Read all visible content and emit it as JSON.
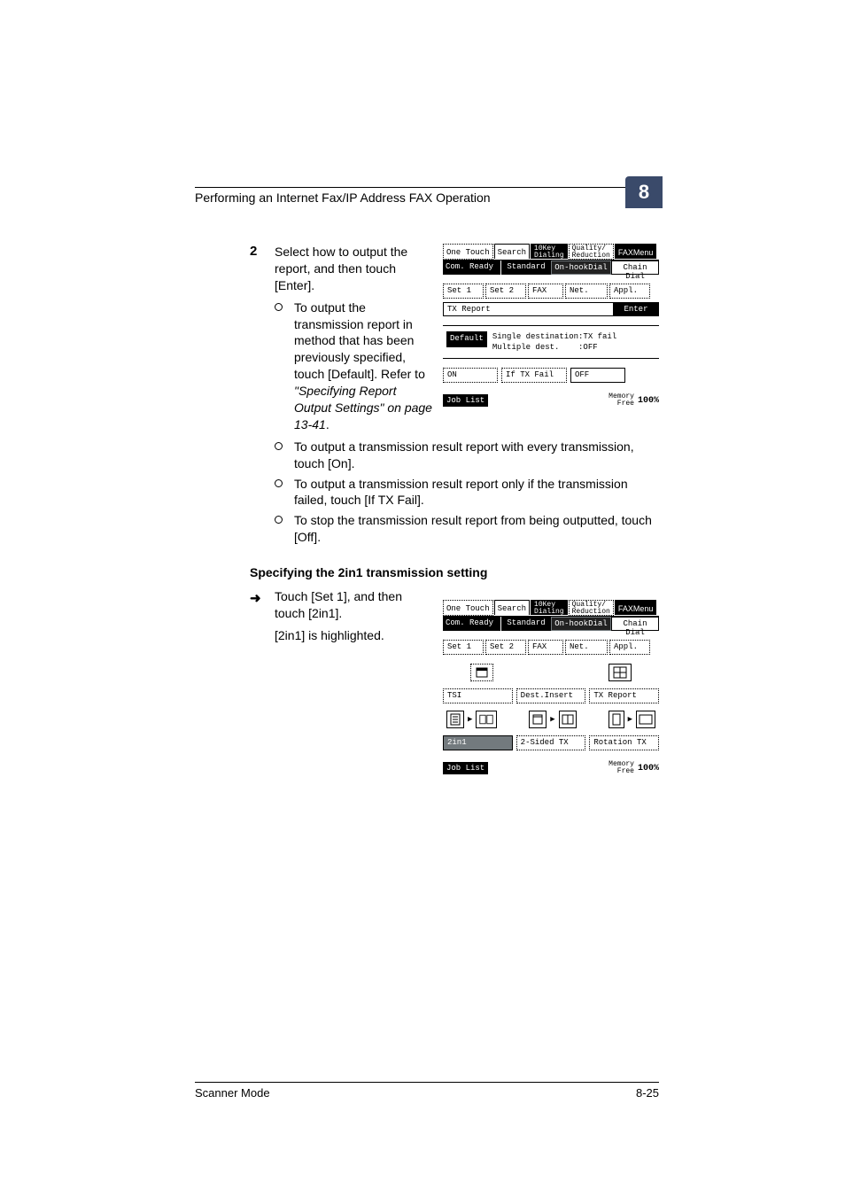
{
  "header": {
    "title": "Performing an Internet Fax/IP Address FAX Operation",
    "chapter": "8"
  },
  "step2": {
    "num": "2",
    "text": "Select how to output the report, and then touch [Enter].",
    "bullets_narrow": [
      {
        "pre": "To output the transmission report in method that has been previously specified, touch [Default]. Refer to ",
        "ref": "\"Specifying Report Output Settings\" on page 13-41",
        "post": "."
      }
    ],
    "bullets_wide": [
      "To output a transmission result report with every transmission, touch [On].",
      "To output a transmission result report only if the transmission failed, touch [If TX Fail].",
      "To stop the transmission result report from being outputted, touch [Off]."
    ]
  },
  "subheading": "Specifying the 2in1 transmission setting",
  "arrowstep": {
    "p1": "Touch [Set 1], and then touch [2in1].",
    "p2": "[2in1] is highlighted."
  },
  "lcd_common": {
    "tabs": {
      "onetouch": "One Touch",
      "search": "Search",
      "dialing_top": "10Key",
      "dialing_bot": "Dialing",
      "quality_top": "Quality/",
      "quality_bot": "Reduction",
      "faxmenu": "FAXMenu"
    },
    "status": {
      "ready": "Com. Ready",
      "standard": "Standard",
      "onhook": "On-hookDial",
      "chain": "Chain Dial"
    },
    "sets": {
      "set1": "Set 1",
      "set2": "Set 2",
      "fax": "FAX",
      "net": "Net.",
      "appl": "Appl."
    },
    "footer": {
      "joblist": "Job List",
      "memory": "Memory",
      "free": "Free",
      "pct": "100%"
    }
  },
  "lcd1": {
    "txreport": "TX Report",
    "enter": "Enter",
    "default": "Default",
    "mid_l1": "Single destination:TX fail",
    "mid_l2": "Multiple dest.    :OFF",
    "on": "ON",
    "iftx": "If TX Fail",
    "off": "OFF"
  },
  "lcd2": {
    "tsi": "TSI",
    "destinsert": "Dest.Insert",
    "txreport": "TX Report",
    "twoin1": "2in1",
    "twosided": "2-Sided TX",
    "rotation": "Rotation TX"
  },
  "footer": {
    "left": "Scanner Mode",
    "right": "8-25"
  }
}
